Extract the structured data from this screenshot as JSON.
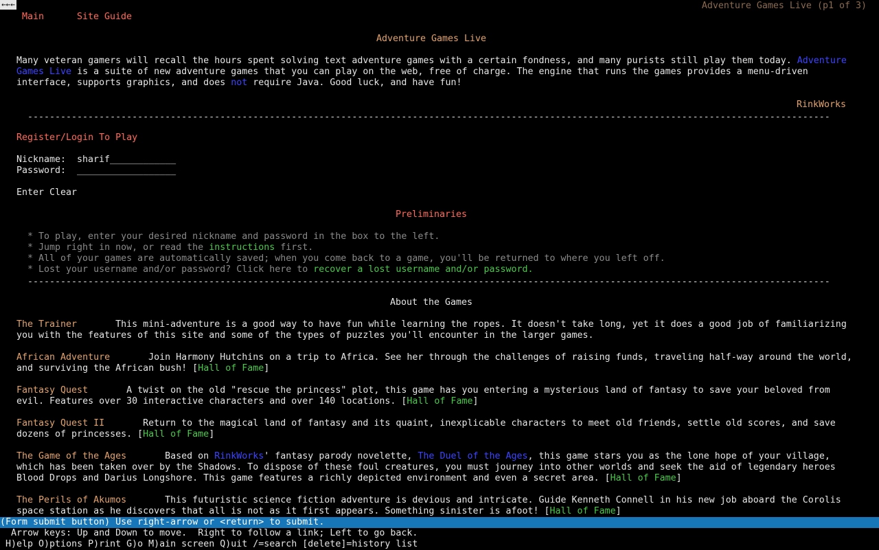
{
  "back": "←←←",
  "page_title": "Adventure Games Live (p1 of 3)",
  "nav": {
    "main": "Main",
    "site_guide": "Site Guide"
  },
  "site_title": "Adventure Games Live",
  "intro": {
    "p1": "Many veteran gamers will recall the hours spent solving text adventure games with a certain fondness, and many purists still play them today. ",
    "link_agl": "Adventure Games Live",
    "p2": " is a suite of new adventure games that you can play on the web, free of charge. The engine that runs the games provides a menu-driven interface, supports graphics, and does ",
    "not": "not",
    "p3": " require Java. Good luck, and have fun!"
  },
  "rinkworks": "RinkWorks",
  "hr": "--------------------------------------------------------------------------------------------------------------------------------------------------------------------------------",
  "login": {
    "heading": "Register/Login To Play",
    "nickname_label": "Nickname:",
    "nickname_value": "sharif____________",
    "password_label": "Password:",
    "password_value": "__________________",
    "enter": "Enter",
    "clear": "Clear"
  },
  "preliminaries": {
    "heading": "Preliminaries",
    "b1": "* To play, enter your desired nickname and password in the box to the left.",
    "b2_pre": "* Jump right in now, or read the ",
    "b2_link": "instructions",
    "b2_post": " first.",
    "b3": "* All of your games are automatically saved; when you come back to a game, you'll be returned to where you left off.",
    "b4_pre": "* Lost your username and/or password? Click here to ",
    "b4_link": "recover a lost username and/or password."
  },
  "about_heading": "About the Games",
  "games": {
    "trainer": {
      "title": "The Trainer",
      "desc": "       This mini-adventure is a good way to have fun while learning the ropes. It doesn't take long, yet it does a good job of familiarizing you with the features of this site and some of the types of puzzles you'll encounter in the larger games."
    },
    "african": {
      "title": "African Adventure",
      "desc": "       Join Harmony Hutchins on a trip to Africa. See her through the challenges of raising funds, traveling half-way around the world, and surviving the African bush! [",
      "hof": "Hall of Fame",
      "close": "]"
    },
    "fantasy": {
      "title": "Fantasy Quest",
      "desc": "       A twist on the old \"rescue the princess\" plot, this game has you entering a mysterious land of fantasy to save your beloved from evil. Features over 30 interactive characters and over 140 locations. [",
      "hof": "Hall of Fame",
      "close": "]"
    },
    "fantasy2": {
      "title": "Fantasy Quest II",
      "desc": "       Return to the magical land of fantasy and its quaint, inexplicable characters to meet old friends, settle old scores, and save dozens of princesses. [",
      "hof": "Hall of Fame",
      "close": "]"
    },
    "ages": {
      "title": "The Game of the Ages",
      "desc1": "       Based on ",
      "link_rw": "RinkWorks",
      "desc2": "' fantasy parody novelette, ",
      "link_duel": "The Duel of the Ages",
      "desc3": ", this game stars you as the lone hope of your village, which has been taken over by the Shadows. To dispose of these foul creatures, you must journey into other worlds and seek the aid of legendary heroes Blood Drops and Darius Longshore. This game features a richly depicted environment and even a secret area. [",
      "hof": "Hall of Fame",
      "close": "]"
    },
    "akumos": {
      "title": "The Perils of Akumos",
      "desc": "       This futuristic science fiction adventure is devious and intricate. Guide Kenneth Connell in his new job aboard the Corolis space station as he discovers that all is not as it first appears. Something sinister is afoot! [",
      "hof": "Hall of Fame",
      "close": "]"
    }
  },
  "status_bar": "(Form submit button) Use right-arrow or <return> to submit.",
  "help1": "  Arrow keys: Up and Down to move.  Right to follow a link; Left to go back.",
  "help2": " H)elp O)ptions P)rint G)o M)ain screen Q)uit /=search [delete]=history list"
}
